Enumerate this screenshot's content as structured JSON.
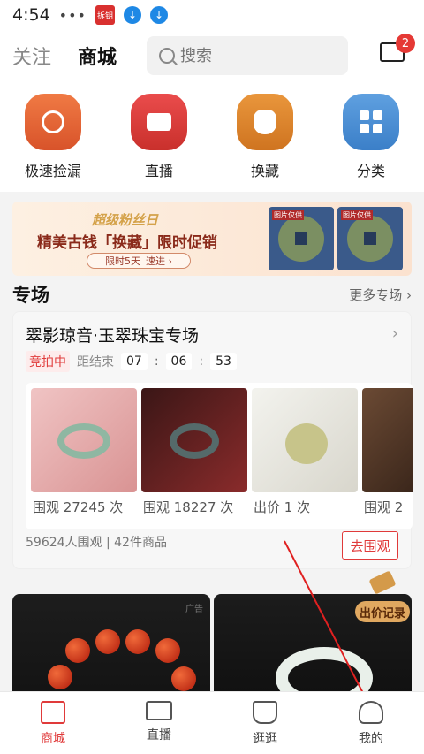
{
  "status_bar": {
    "time": "4:54",
    "dots": "•••",
    "app_badge": "拆钥",
    "download_glyph": "↓"
  },
  "header": {
    "tab_follow": "关注",
    "tab_mall": "商城",
    "search_placeholder": "搜索",
    "message_badge": "2"
  },
  "categories": [
    {
      "label": "极速捡漏",
      "icon": "stopwatch-icon",
      "color": "#e06030"
    },
    {
      "label": "直播",
      "icon": "video-camera-icon",
      "color": "#d63a3a"
    },
    {
      "label": "换藏",
      "icon": "money-bag-icon",
      "color": "#dc8228"
    },
    {
      "label": "分类",
      "icon": "grid-icon",
      "color": "#4a8ed2"
    }
  ],
  "banner": {
    "slogan": "超级粉丝日",
    "headline": "精美古钱「换藏」限时促销",
    "duration": "限时5天",
    "cta": "速进 ›",
    "coin_tag_1": "图片仅供",
    "coin_tag_2": "图片仅供"
  },
  "section": {
    "title": "专场",
    "more": "更多专场 ›"
  },
  "special": {
    "title": "翠影琼音·玉翠珠宝专场",
    "chevron": "›",
    "status": "竞拍中",
    "countdown_label": "距结束",
    "hh": "07",
    "mm": "06",
    "ss": "53",
    "items": [
      {
        "caption": "围观 27245 次"
      },
      {
        "caption": "围观 18227 次"
      },
      {
        "caption": "出价 1 次"
      },
      {
        "caption": "围观 2"
      }
    ],
    "footer": "59624人围观 | 42件商品",
    "button": "去围观"
  },
  "tiles": {
    "ad_label": "广告",
    "bid_record": "出价记录"
  },
  "tabbar": [
    {
      "label": "商城",
      "active": true
    },
    {
      "label": "直播",
      "active": false
    },
    {
      "label": "逛逛",
      "active": false
    },
    {
      "label": "我的",
      "active": false
    }
  ],
  "colors": {
    "accent": "#e03a3a",
    "arrow": "#e02020"
  }
}
